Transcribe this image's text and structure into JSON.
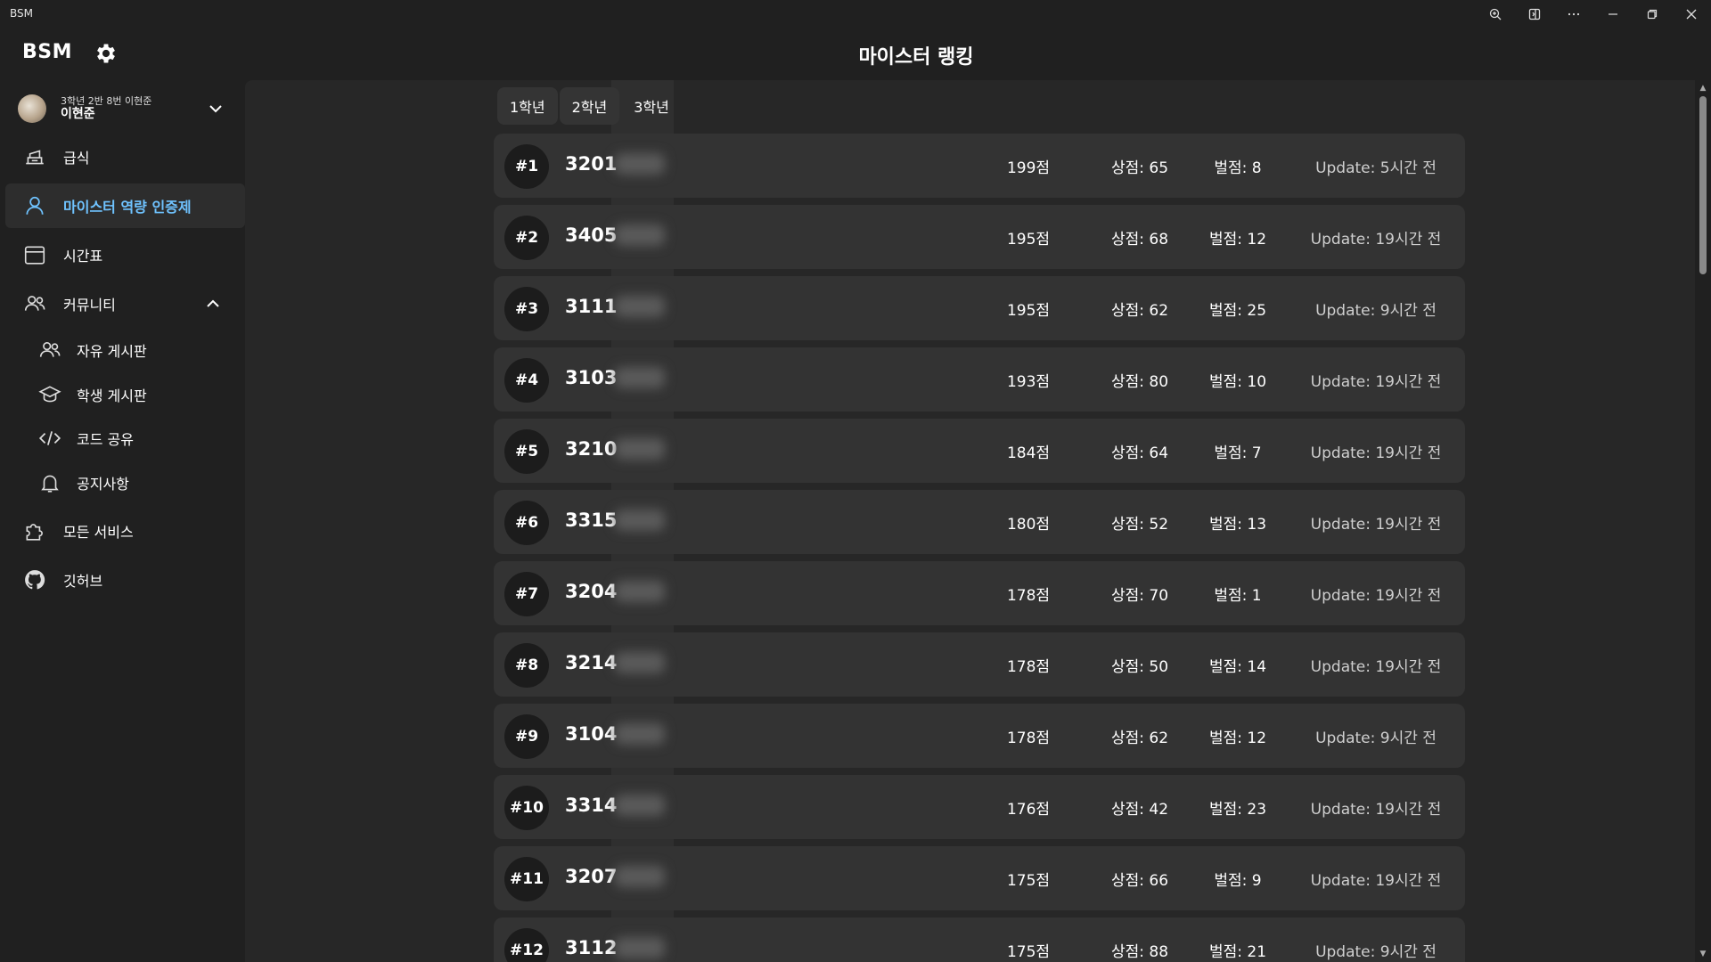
{
  "window": {
    "title": "BSM"
  },
  "sidebar": {
    "brand": "BSM",
    "profile": {
      "sub": "3학년 2반 8번 이현준",
      "name": "이현준"
    },
    "items": [
      {
        "label": "급식",
        "icon": "meal-icon"
      },
      {
        "label": "마이스터 역량 인증제",
        "icon": "person-icon",
        "active": true
      },
      {
        "label": "시간표",
        "icon": "calendar-icon"
      },
      {
        "label": "커뮤니티",
        "icon": "people-icon",
        "expanded": true
      },
      {
        "label": "자유 게시판",
        "icon": "people-icon"
      },
      {
        "label": "학생 게시판",
        "icon": "graduation-cap-icon"
      },
      {
        "label": "코드 공유",
        "icon": "code-icon"
      },
      {
        "label": "공지사항",
        "icon": "bell-icon"
      },
      {
        "label": "모든 서비스",
        "icon": "puzzle-icon"
      },
      {
        "label": "깃허브",
        "icon": "github-icon"
      }
    ]
  },
  "header": {
    "title": "마이스터 랭킹"
  },
  "tabs": [
    "1학년",
    "2학년",
    "3학년"
  ],
  "selected_tab": "2학년",
  "ranking": [
    {
      "rank": "#1",
      "id": "3201",
      "score": "199점",
      "merit": "상점: 65",
      "demerit": "벌점: 8",
      "update": "Update: 5시간 전"
    },
    {
      "rank": "#2",
      "id": "3405",
      "score": "195점",
      "merit": "상점: 68",
      "demerit": "벌점: 12",
      "update": "Update: 19시간 전"
    },
    {
      "rank": "#3",
      "id": "3111",
      "score": "195점",
      "merit": "상점: 62",
      "demerit": "벌점: 25",
      "update": "Update: 9시간 전"
    },
    {
      "rank": "#4",
      "id": "3103",
      "score": "193점",
      "merit": "상점: 80",
      "demerit": "벌점: 10",
      "update": "Update: 19시간 전"
    },
    {
      "rank": "#5",
      "id": "3210",
      "score": "184점",
      "merit": "상점: 64",
      "demerit": "벌점: 7",
      "update": "Update: 19시간 전"
    },
    {
      "rank": "#6",
      "id": "3315",
      "score": "180점",
      "merit": "상점: 52",
      "demerit": "벌점: 13",
      "update": "Update: 19시간 전"
    },
    {
      "rank": "#7",
      "id": "3204",
      "score": "178점",
      "merit": "상점: 70",
      "demerit": "벌점: 1",
      "update": "Update: 19시간 전"
    },
    {
      "rank": "#8",
      "id": "3214",
      "score": "178점",
      "merit": "상점: 50",
      "demerit": "벌점: 14",
      "update": "Update: 19시간 전"
    },
    {
      "rank": "#9",
      "id": "3104",
      "score": "178점",
      "merit": "상점: 62",
      "demerit": "벌점: 12",
      "update": "Update: 9시간 전"
    },
    {
      "rank": "#10",
      "id": "3314",
      "score": "176점",
      "merit": "상점: 42",
      "demerit": "벌점: 23",
      "update": "Update: 19시간 전"
    },
    {
      "rank": "#11",
      "id": "3207",
      "score": "175점",
      "merit": "상점: 66",
      "demerit": "벌점: 9",
      "update": "Update: 19시간 전"
    },
    {
      "rank": "#12",
      "id": "3112",
      "score": "175점",
      "merit": "상점: 88",
      "demerit": "벌점: 21",
      "update": "Update: 9시간 전"
    }
  ],
  "colors": {
    "accent": "#6fc3ff",
    "background": "#202020",
    "panel": "#272727",
    "row": "#333333"
  }
}
